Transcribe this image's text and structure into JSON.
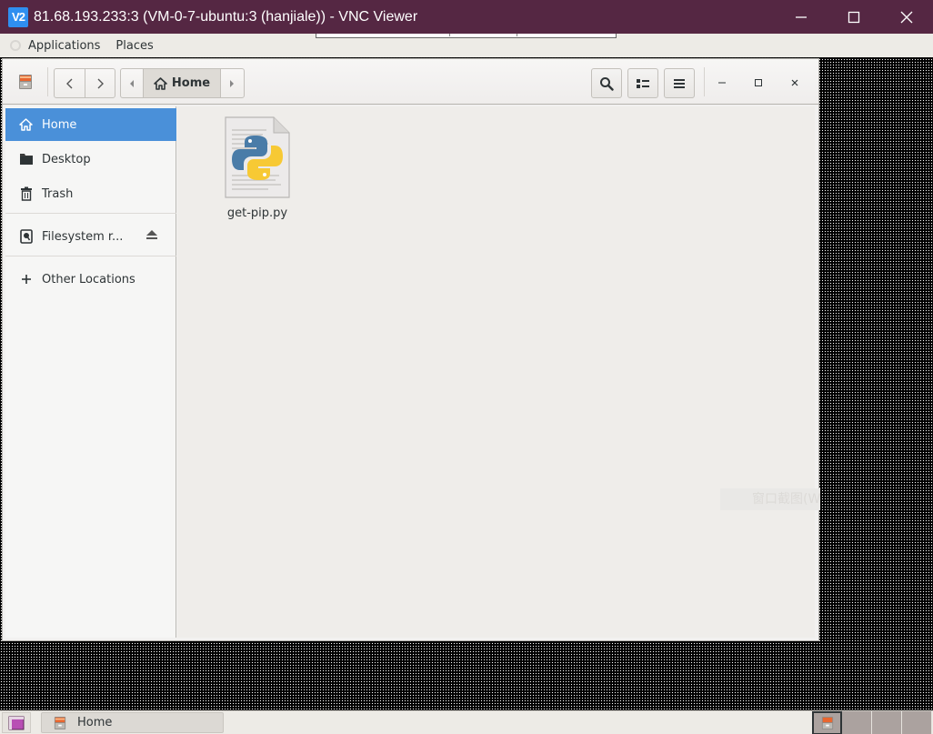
{
  "vnc": {
    "logo_text": "V2",
    "title": "81.68.193.233:3 (VM-0-7-ubuntu:3 (hanjiale)) - VNC Viewer",
    "controls": [
      "minimize-icon",
      "maximize-icon",
      "close-icon"
    ]
  },
  "top_panel": {
    "menus": [
      {
        "label": "Applications"
      },
      {
        "label": "Places"
      }
    ]
  },
  "file_manager": {
    "headerbar": {
      "back_icon": "chevron-left-icon",
      "forward_icon": "chevron-right-icon",
      "path_current": "Home",
      "search_icon": "search-icon",
      "view_icon": "list-view-icon",
      "menu_icon": "hamburger-menu-icon"
    },
    "sidebar": {
      "items": [
        {
          "label": "Home",
          "icon": "home-icon",
          "active": true
        },
        {
          "label": "Desktop",
          "icon": "folder-icon",
          "active": false
        },
        {
          "label": "Trash",
          "icon": "trash-icon",
          "active": false
        },
        {
          "label": "Filesystem r...",
          "icon": "drive-icon",
          "active": false
        },
        {
          "label": "Other Locations",
          "icon": "plus-icon",
          "active": false
        }
      ]
    },
    "files": [
      {
        "name": "get-pip.py",
        "icon": "python-file-icon"
      }
    ],
    "watermark": "窗口截图(W"
  },
  "taskbar": {
    "windows": [
      {
        "label": "Home"
      }
    ],
    "workspace_count": 4,
    "active_workspace": 1
  },
  "colors": {
    "vnc_titlebar": "#552743",
    "sidebar_active": "#4a90d9",
    "panel_bg": "#edebe6"
  }
}
